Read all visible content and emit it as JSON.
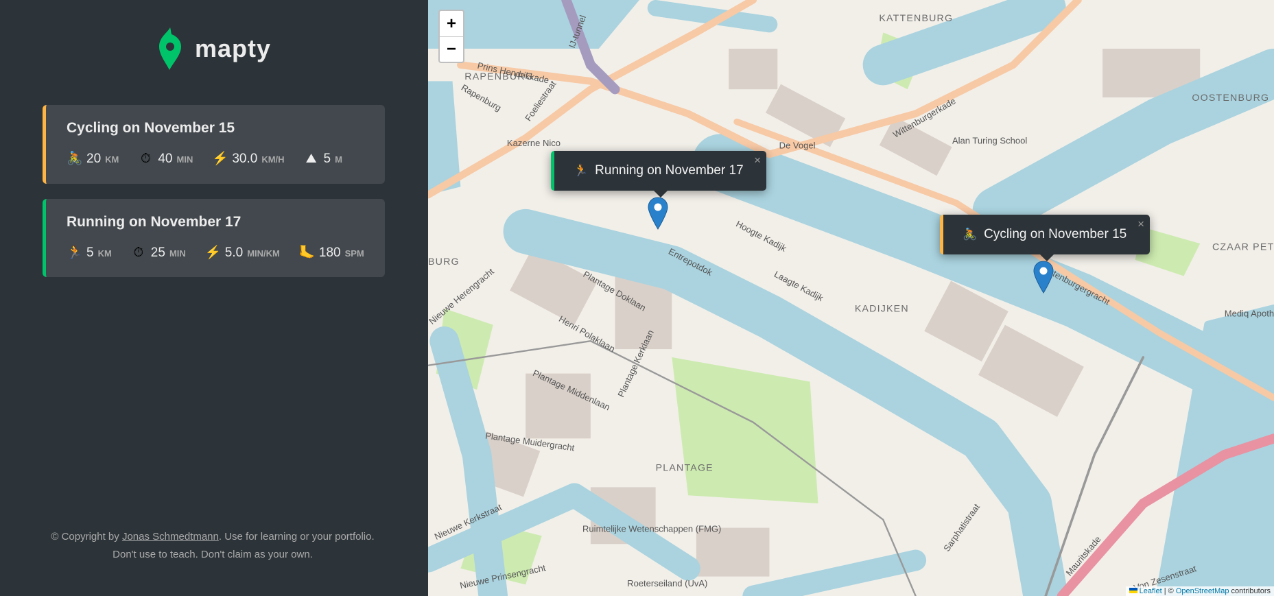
{
  "app": {
    "name": "mapty",
    "brand_color": "#00c46a"
  },
  "workouts": [
    {
      "type": "cycling",
      "title": "Cycling on November 15",
      "accent": "#ffb545",
      "details": [
        {
          "icon": "cyclist-icon",
          "glyph": "🚴",
          "value": "20",
          "unit": "km"
        },
        {
          "icon": "stopwatch-icon",
          "glyph": "⏱",
          "value": "40",
          "unit": "min"
        },
        {
          "icon": "lightning-icon",
          "glyph": "⚡",
          "value": "30.0",
          "unit": "km/h"
        },
        {
          "icon": "mountain-icon",
          "glyph": "⛰",
          "value": "5",
          "unit": "m"
        }
      ]
    },
    {
      "type": "running",
      "title": "Running on November 17",
      "accent": "#00c46a",
      "details": [
        {
          "icon": "runner-icon",
          "glyph": "🏃",
          "value": "5",
          "unit": "km"
        },
        {
          "icon": "stopwatch-icon",
          "glyph": "⏱",
          "value": "25",
          "unit": "min"
        },
        {
          "icon": "lightning-icon",
          "glyph": "⚡",
          "value": "5.0",
          "unit": "min/km"
        },
        {
          "icon": "foot-icon",
          "glyph": "🦶",
          "value": "180",
          "unit": "spm"
        }
      ]
    }
  ],
  "footer": {
    "prefix": "© Copyright by ",
    "author": "Jonas Schmedtmann",
    "suffix": ". Use for learning or your portfolio. Don't use to teach. Don't claim as your own."
  },
  "map": {
    "zoom_in": "+",
    "zoom_out": "−",
    "popups": [
      {
        "glyph": "🏃",
        "icon": "runner-icon",
        "text": "Running on November 17",
        "accent": "#00c46a",
        "close": "×"
      },
      {
        "glyph": "🚴",
        "icon": "cyclist-icon",
        "text": "Cycling on November 15",
        "accent": "#ffb545",
        "close": "×"
      }
    ],
    "labels": [
      "KATTENBURG",
      "RAPENBURG",
      "OOSTENBURG",
      "KADIJKEN",
      "PLANTAGE",
      "CZAAR PET",
      "Prins Hendrikkade",
      "Rapenburg",
      "Foeliestraat",
      "IJ-tunnel",
      "Kazerne Nico",
      "De Vogel",
      "Alan Turing School",
      "Wittenburgerkade",
      "Hoogte Kadijk",
      "Entrepotdok",
      "Laagte Kadijk",
      "Plantage Doklaan",
      "Henri Polaklaan",
      "Plantage Kerklaan",
      "Plantage Middenlaan",
      "Plantage Muidergracht",
      "Nieuwe Herengracht",
      "Nieuwe Kerkstraat",
      "Ruimtelijke Wetenschappen (FMG)",
      "Roeterseiland (UvA)",
      "Nieuwe Prinsengracht",
      "Oostenburgergracht",
      "Sarphatistraat",
      "Mauritskade",
      "Von Zesenstraat",
      "Mediq Apotheek Czaar Peter",
      "BURG"
    ],
    "attribution": {
      "leaflet": "Leaflet",
      "sep": " | © ",
      "osm": "OpenStreetMap",
      "tail": " contributors"
    },
    "colors": {
      "water": "#aad3df",
      "land": "#f2efe9",
      "park": "#cdebb0",
      "road": "#f7c9a5",
      "rail": "#e892a2",
      "marker": "#2a81cb"
    }
  }
}
